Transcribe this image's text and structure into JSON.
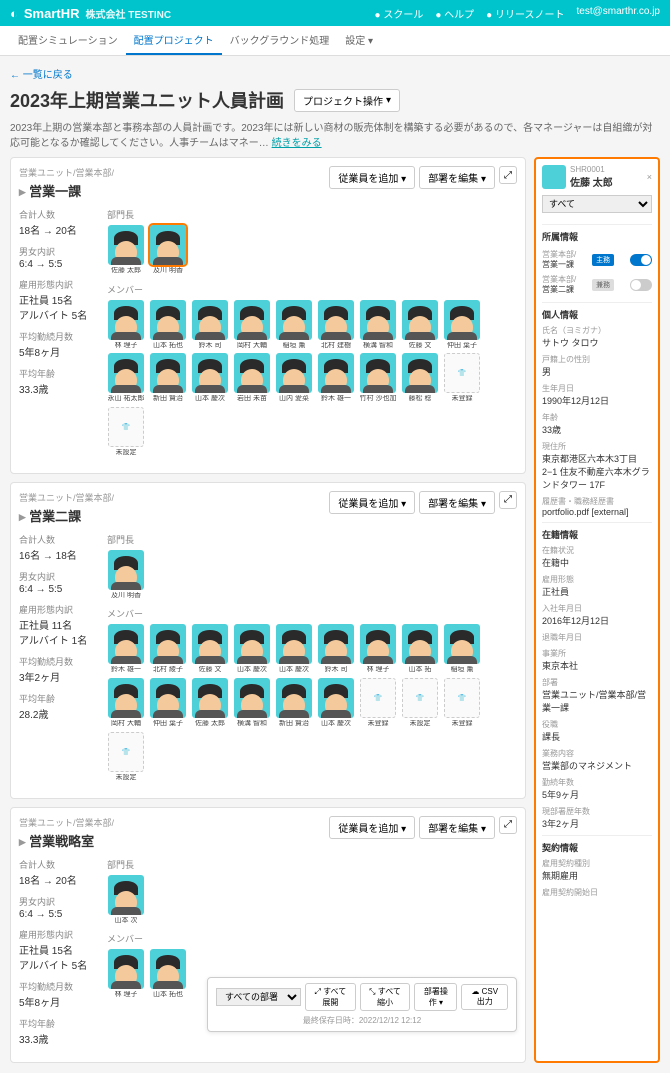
{
  "topbar": {
    "brand": "SmartHR",
    "company": "株式会社 TESTINC",
    "links": [
      "スクール",
      "ヘルプ",
      "リリースノート",
      "test@smarthr.co.jp"
    ]
  },
  "tabs": [
    "配置シミュレーション",
    "配置プロジェクト",
    "バックグラウンド処理",
    "設定"
  ],
  "back": "← 一覧に戻る",
  "title": "2023年上期営業ユニット人員計画",
  "project_btn": "プロジェクト操作",
  "desc": "2023年上期の営業本部と事務本部の人員計画です。2023年には新しい商材の販売体制を構築する必要があるので、各マネージャーは自組織が対応可能となるか確認してください。人事チームはマネー…",
  "more": "続きをみる",
  "add_emp": "従業員を追加",
  "edit_dept": "部署を編集",
  "depts": [
    {
      "crumb": "営業ユニット/営業本部/",
      "name": "営業一課",
      "stats": [
        {
          "lbl": "合計人数",
          "val": "18名 → 20名"
        },
        {
          "lbl": "男女内訳",
          "val": "6:4 → 5:5"
        },
        {
          "lbl": "雇用形態内訳",
          "val": "正社員 15名\nアルバイト 5名"
        },
        {
          "lbl": "平均勤続月数",
          "val": "5年8ヶ月"
        },
        {
          "lbl": "平均年齢",
          "val": "33.3歳"
        }
      ],
      "leaders": [
        "佐藤 太郎",
        "及川 明香"
      ],
      "members": [
        "林 理子",
        "山本 拓也",
        "鈴木 司",
        "岡村 大輔",
        "稲垣 薫",
        "北村 建樹",
        "横溝 智和",
        "佐藤 文",
        "仲田 葉子",
        "永山 祐太郎",
        "新田 賢治",
        "山本 慶次",
        "岩田 未苗",
        "山内 愛菜",
        "鈴木 雄一",
        "竹村 沙也加",
        "藤松 稔"
      ],
      "slots": [
        "未登録",
        "未設定"
      ]
    },
    {
      "crumb": "営業ユニット/営業本部/",
      "name": "営業二課",
      "stats": [
        {
          "lbl": "合計人数",
          "val": "16名 → 18名"
        },
        {
          "lbl": "男女内訳",
          "val": "6:4 → 5:5"
        },
        {
          "lbl": "雇用形態内訳",
          "val": "正社員 11名\nアルバイト 1名"
        },
        {
          "lbl": "平均勤続月数",
          "val": "3年2ヶ月"
        },
        {
          "lbl": "平均年齢",
          "val": "28.2歳"
        }
      ],
      "leaders": [
        "及川 明香"
      ],
      "members": [
        "鈴木 雄一",
        "北村 綾子",
        "佐藤 文",
        "山本 慶次",
        "山本 慶次",
        "鈴木 司",
        "林 理子",
        "山本 拓",
        "稲垣 薫",
        "岡村 大輔",
        "仲田 葉子",
        "佐藤 太郎",
        "横溝 智和",
        "新田 賢治",
        "山本 慶次"
      ],
      "slots": [
        "未登録",
        "未設定",
        "未登録",
        "未設定"
      ]
    },
    {
      "crumb": "営業ユニット/営業本部/",
      "name": "営業戦略室",
      "stats": [
        {
          "lbl": "合計人数",
          "val": "18名 → 20名"
        },
        {
          "lbl": "男女内訳",
          "val": "6:4 → 5:5"
        },
        {
          "lbl": "雇用形態内訳",
          "val": "正社員 15名\nアルバイト 5名"
        },
        {
          "lbl": "平均勤続月数",
          "val": "5年8ヶ月"
        },
        {
          "lbl": "平均年齢",
          "val": "33.3歳"
        }
      ],
      "leaders": [
        "山本 次"
      ],
      "members": [
        "林 理子",
        "山本 拓也"
      ],
      "slots": []
    }
  ],
  "sec_leader": "部門長",
  "sec_member": "メンバー",
  "bottom": {
    "dept_sel": "すべての部署",
    "expand": "すべて展開",
    "collapse": "すべて縮小",
    "dept_op": "部署操作",
    "csv": "CSV出力",
    "ts": "最終保存日時：2022/12/12 12:12"
  },
  "side": {
    "id": "SHR0001",
    "name": "佐藤 太郎",
    "filter": "すべて",
    "sec_affil": "所属情報",
    "affils": [
      {
        "path": "営業本部/",
        "dept": "営業一課",
        "badge": "主務",
        "on": true
      },
      {
        "path": "営業本部/",
        "dept": "営業二課",
        "badge": "兼務",
        "on": false
      }
    ],
    "sec_personal": "個人情報",
    "personal": [
      {
        "k": "氏名（ヨミガナ）",
        "v": "サトウ タロウ"
      },
      {
        "k": "戸籍上の性別",
        "v": "男"
      },
      {
        "k": "生年月日",
        "v": "1990年12月12日"
      },
      {
        "k": "年齢",
        "v": "33歳"
      },
      {
        "k": "現住所",
        "v": "東京都港区六本木3丁目2−1 住友不動産六本木グランドタワー 17F"
      },
      {
        "k": "履歴書・職務経歴書",
        "v": "portfolio.pdf [external]",
        "link": true
      }
    ],
    "sec_enroll": "在籍情報",
    "enroll": [
      {
        "k": "在籍状況",
        "v": "在籍中"
      },
      {
        "k": "雇用形態",
        "v": "正社員"
      },
      {
        "k": "入社年月日",
        "v": "2016年12月12日"
      },
      {
        "k": "退職年月日",
        "v": ""
      },
      {
        "k": "事業所",
        "v": "東京本社"
      },
      {
        "k": "部署",
        "v": "営業ユニット/営業本部/営業一課"
      },
      {
        "k": "役職",
        "v": "課長"
      },
      {
        "k": "業務内容",
        "v": "営業部のマネジメント"
      },
      {
        "k": "勤続年数",
        "v": "5年9ヶ月"
      },
      {
        "k": "現部署歴年数",
        "v": "3年2ヶ月"
      }
    ],
    "sec_contract": "契約情報",
    "contract": [
      {
        "k": "雇用契約種別",
        "v": "無期雇用"
      },
      {
        "k": "雇用契約開始日",
        "v": ""
      }
    ]
  }
}
